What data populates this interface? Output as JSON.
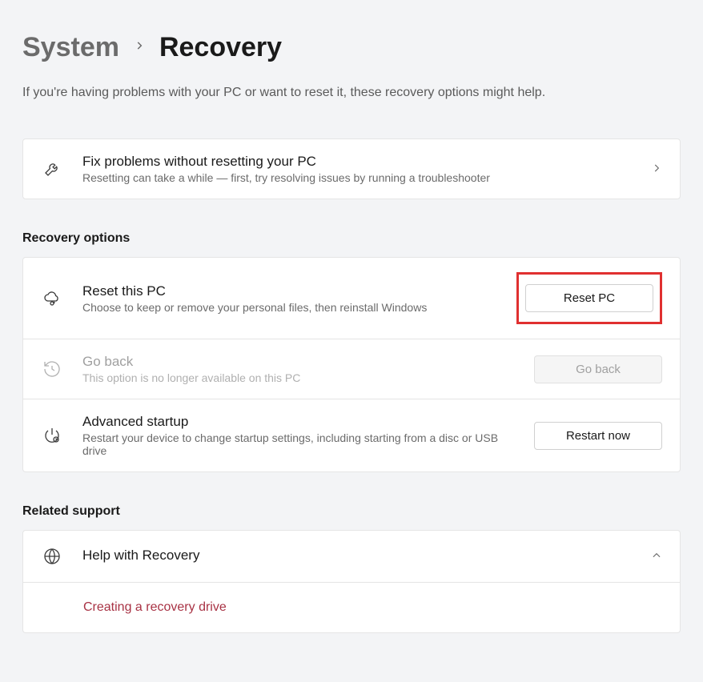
{
  "breadcrumb": {
    "parent": "System",
    "current": "Recovery"
  },
  "subtitle": "If you're having problems with your PC or want to reset it, these recovery options might help.",
  "troubleshoot": {
    "title": "Fix problems without resetting your PC",
    "desc": "Resetting can take a while — first, try resolving issues by running a troubleshooter"
  },
  "sections": {
    "recovery_options": "Recovery options",
    "related_support": "Related support"
  },
  "reset": {
    "title": "Reset this PC",
    "desc": "Choose to keep or remove your personal files, then reinstall Windows",
    "button": "Reset PC"
  },
  "goback": {
    "title": "Go back",
    "desc": "This option is no longer available on this PC",
    "button": "Go back"
  },
  "advanced": {
    "title": "Advanced startup",
    "desc": "Restart your device to change startup settings, including starting from a disc or USB drive",
    "button": "Restart now"
  },
  "help": {
    "title": "Help with Recovery",
    "link": "Creating a recovery drive"
  }
}
